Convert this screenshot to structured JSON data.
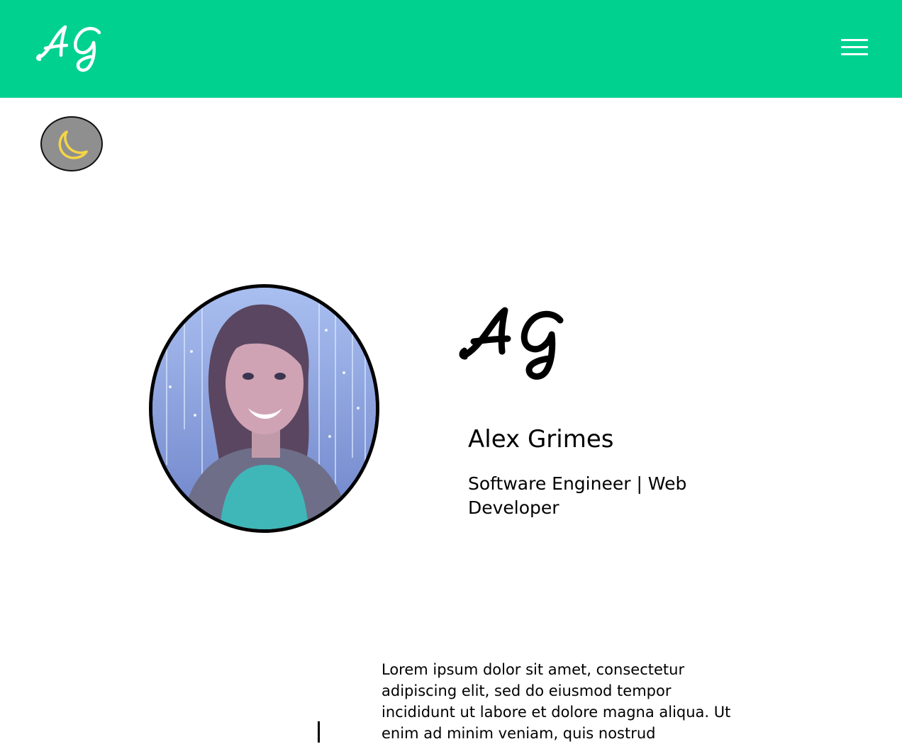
{
  "header": {
    "logo_text": "AG",
    "menu_icon": "hamburger-menu-icon",
    "background_color": "#00d18f"
  },
  "theme_toggle": {
    "icon": "moon-icon",
    "icon_color": "#f5d547",
    "background_color": "#8f8f8f"
  },
  "hero": {
    "avatar_icon": "profile-photo",
    "logo_text": "AG",
    "name": "Alex Grimes",
    "role": "Software Engineer | Web Developer"
  },
  "intro": {
    "text": "Lorem ipsum dolor sit amet, consectetur adipiscing elit, sed do eiusmod tempor incididunt ut labore et dolore magna aliqua. Ut enim ad minim veniam, quis nostrud"
  }
}
